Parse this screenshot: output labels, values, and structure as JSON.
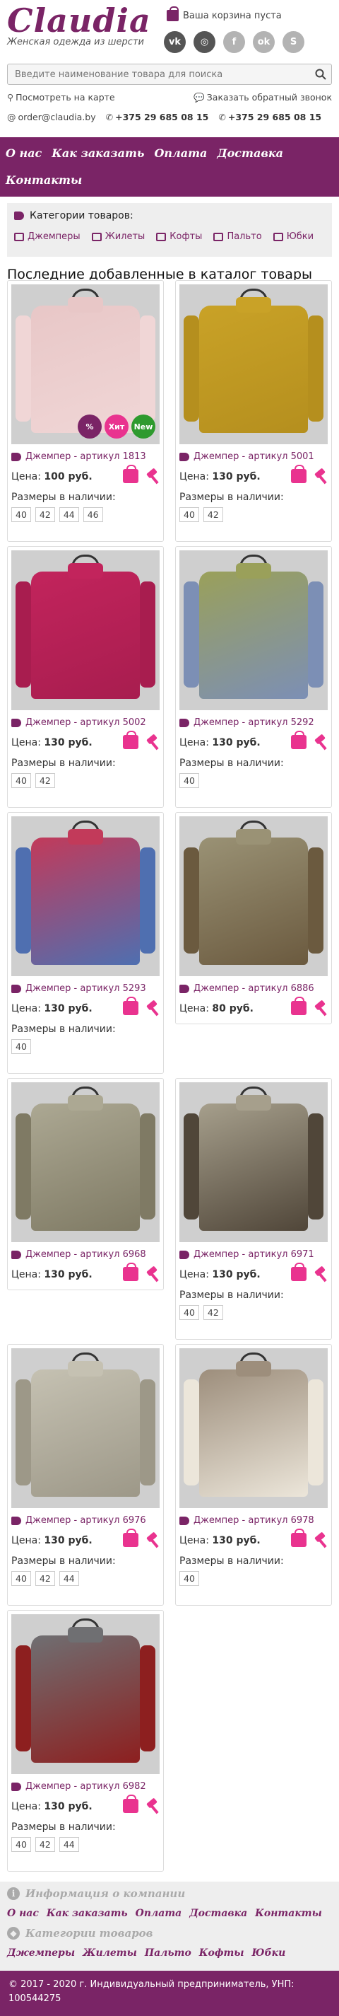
{
  "header": {
    "logo": "Claudia",
    "tagline": "Женская одежда из шерсти",
    "cart_text": "Ваша корзина пуста",
    "socials": [
      "vk-icon",
      "instagram-icon",
      "facebook-icon",
      "odnoklassniki-icon",
      "skype-icon"
    ],
    "search_placeholder": "Введите наименование товара для поиска",
    "map_link": "Посмотреть на карте",
    "callback_link": "Заказать обратный звонок",
    "email": "order@claudia.by",
    "phone1": "+375 29 685 08 15",
    "phone2": "+375 29 685 08 15"
  },
  "nav": [
    "О нас",
    "Как заказать",
    "Оплата",
    "Доставка",
    "Контакты"
  ],
  "categories": {
    "title": "Категории товаров:",
    "items": [
      "Джемперы",
      "Жилеты",
      "Кофты",
      "Пальто",
      "Юбки"
    ]
  },
  "section_title": "Последние добавленные в каталог товары",
  "labels": {
    "price": "Цена:",
    "sizes": "Размеры в наличии:"
  },
  "products": [
    {
      "title": "Джемпер - артикул 1813",
      "price": "100 руб.",
      "sizes": [
        "40",
        "42",
        "44",
        "46"
      ],
      "badges": [
        "%",
        "Хит",
        "New"
      ]
    },
    {
      "title": "Джемпер - артикул 5001",
      "price": "130 руб.",
      "sizes": [
        "40",
        "42"
      ],
      "badges": []
    },
    {
      "title": "Джемпер - артикул 5002",
      "price": "130 руб.",
      "sizes": [
        "40",
        "42"
      ],
      "badges": []
    },
    {
      "title": "Джемпер - артикул 5292",
      "price": "130 руб.",
      "sizes": [
        "40"
      ],
      "badges": []
    },
    {
      "title": "Джемпер - артикул 5293",
      "price": "130 руб.",
      "sizes": [
        "40"
      ],
      "badges": []
    },
    {
      "title": "Джемпер - артикул 6886",
      "price": "80 руб.",
      "sizes": [],
      "badges": []
    },
    {
      "title": "Джемпер - артикул 6968",
      "price": "130 руб.",
      "sizes": [],
      "badges": []
    },
    {
      "title": "Джемпер - артикул 6971",
      "price": "130 руб.",
      "sizes": [
        "40",
        "42"
      ],
      "badges": []
    },
    {
      "title": "Джемпер - артикул 6976",
      "price": "130 руб.",
      "sizes": [
        "40",
        "42",
        "44"
      ],
      "badges": []
    },
    {
      "title": "Джемпер - артикул 6978",
      "price": "130 руб.",
      "sizes": [
        "40"
      ],
      "badges": []
    },
    {
      "title": "Джемпер - артикул 6982",
      "price": "130 руб.",
      "sizes": [
        "40",
        "42",
        "44"
      ],
      "badges": []
    }
  ],
  "footer": {
    "info_title": "Информация о компании",
    "info_links": [
      "О нас",
      "Как заказать",
      "Оплата",
      "Доставка",
      "Контакты"
    ],
    "cats_title": "Категории товаров",
    "cats_links": [
      "Джемперы",
      "Жилеты",
      "Пальто",
      "Кофты",
      "Юбки"
    ],
    "copyright": "© 2017 - 2020 г. Индивидуальный предприниматель, УНП: 100544275"
  },
  "colors": {
    "brand": "#7a2466",
    "accent": "#e9338f"
  }
}
